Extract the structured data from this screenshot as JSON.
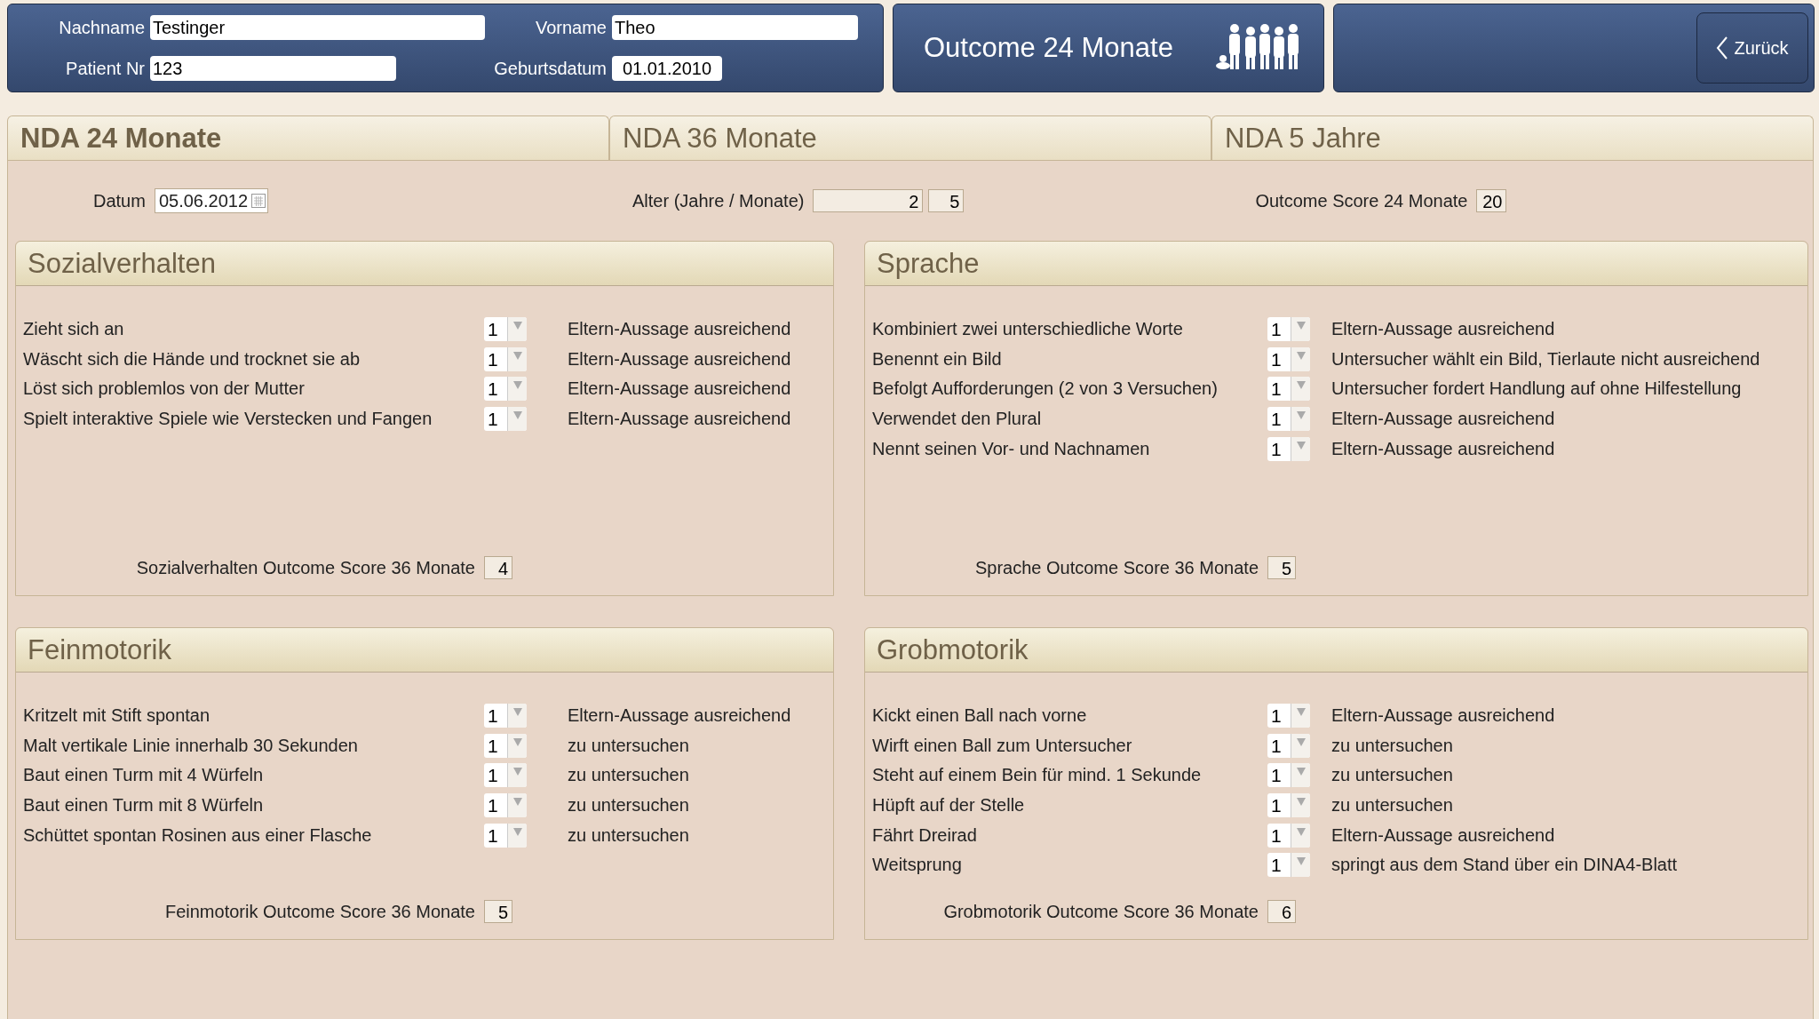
{
  "header": {
    "fields": [
      {
        "label": "Nachname",
        "value": "Testinger"
      },
      {
        "label": "Vorname",
        "value": "Theo"
      },
      {
        "label": "Patient Nr",
        "value": "123"
      },
      {
        "label": "Geburtsdatum",
        "value": "01.01.2010"
      }
    ],
    "title": "Outcome 24 Monate",
    "back_button": "Zurück"
  },
  "tabs": [
    {
      "label": "NDA 24 Monate",
      "selected": true
    },
    {
      "label": "NDA 36 Monate",
      "selected": false
    },
    {
      "label": "NDA 5 Jahre",
      "selected": false
    }
  ],
  "info": {
    "date_label": "Datum",
    "date_value": "05.06.2012",
    "age_label": "Alter (Jahre / Monate)",
    "age_years": "2",
    "age_months": "5",
    "score_label": "Outcome Score 24 Monate",
    "score_value": "20"
  },
  "sections": [
    {
      "title": "Sozialverhalten",
      "items": [
        {
          "label": "Zieht sich an",
          "value": "1",
          "note": "Eltern-Aussage ausreichend"
        },
        {
          "label": "Wäscht sich die Hände und trocknet sie ab",
          "value": "1",
          "note": "Eltern-Aussage ausreichend"
        },
        {
          "label": "Löst sich problemlos von der Mutter",
          "value": "1",
          "note": "Eltern-Aussage ausreichend"
        },
        {
          "label": "Spielt interaktive Spiele wie Verstecken und Fangen",
          "value": "1",
          "note": "Eltern-Aussage ausreichend"
        }
      ],
      "score_label": "Sozialverhalten Outcome Score 36 Monate",
      "score_value": "4"
    },
    {
      "title": "Sprache",
      "items": [
        {
          "label": "Kombiniert zwei unterschiedliche Worte",
          "value": "1",
          "note": "Eltern-Aussage ausreichend"
        },
        {
          "label": "Benennt ein Bild",
          "value": "1",
          "note": "Untersucher wählt ein Bild, Tierlaute nicht ausreichend"
        },
        {
          "label": "Befolgt Aufforderungen (2 von 3 Versuchen)",
          "value": "1",
          "note": "Untersucher fordert Handlung auf ohne Hilfestellung"
        },
        {
          "label": "Verwendet den Plural",
          "value": "1",
          "note": "Eltern-Aussage ausreichend"
        },
        {
          "label": "Nennt seinen Vor- und Nachnamen",
          "value": "1",
          "note": "Eltern-Aussage ausreichend"
        }
      ],
      "score_label": "Sprache Outcome Score 36 Monate",
      "score_value": "5"
    },
    {
      "title": "Feinmotorik",
      "items": [
        {
          "label": "Kritzelt mit Stift spontan",
          "value": "1",
          "note": "Eltern-Aussage ausreichend"
        },
        {
          "label": "Malt vertikale Linie innerhalb 30 Sekunden",
          "value": "1",
          "note": "zu untersuchen"
        },
        {
          "label": "Baut einen Turm mit 4 Würfeln",
          "value": "1",
          "note": "zu untersuchen"
        },
        {
          "label": "Baut einen Turm mit 8 Würfeln",
          "value": "1",
          "note": "zu untersuchen"
        },
        {
          "label": "Schüttet spontan Rosinen aus einer Flasche",
          "value": "1",
          "note": "zu untersuchen"
        }
      ],
      "score_label": "Feinmotorik Outcome Score 36 Monate",
      "score_value": "5"
    },
    {
      "title": "Grobmotorik",
      "items": [
        {
          "label": "Kickt einen Ball nach vorne",
          "value": "1",
          "note": "Eltern-Aussage ausreichend"
        },
        {
          "label": "Wirft einen Ball zum Untersucher",
          "value": "1",
          "note": "zu untersuchen"
        },
        {
          "label": "Steht auf einem Bein für mind. 1 Sekunde",
          "value": "1",
          "note": "zu untersuchen"
        },
        {
          "label": "Hüpft auf der Stelle",
          "value": "1",
          "note": "zu untersuchen"
        },
        {
          "label": "Fährt Dreirad",
          "value": "1",
          "note": "Eltern-Aussage ausreichend"
        },
        {
          "label": "Weitsprung",
          "value": "1",
          "note": "springt aus dem Stand über ein DINA4-Blatt"
        }
      ],
      "score_label": "Grobmotorik Outcome Score 36 Monate",
      "score_value": "6"
    }
  ]
}
